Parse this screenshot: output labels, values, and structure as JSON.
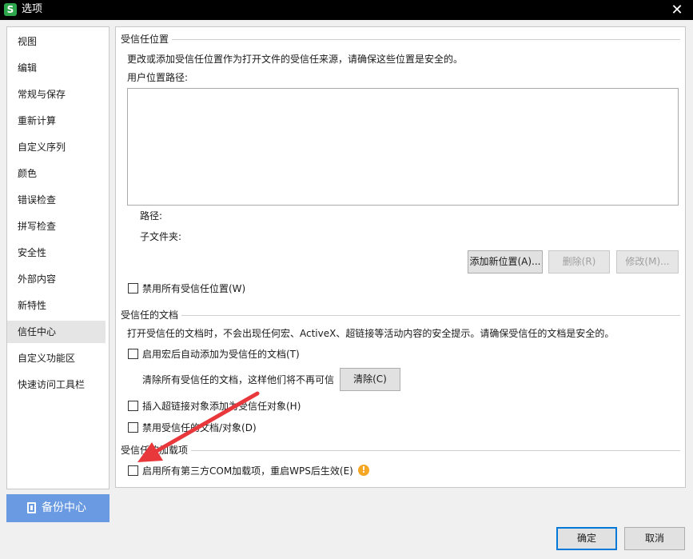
{
  "window": {
    "app_icon": "S",
    "title": "选项",
    "close_glyph": "✕"
  },
  "sidebar": {
    "items": [
      {
        "label": "视图"
      },
      {
        "label": "编辑"
      },
      {
        "label": "常规与保存"
      },
      {
        "label": "重新计算"
      },
      {
        "label": "自定义序列"
      },
      {
        "label": "颜色"
      },
      {
        "label": "错误检查"
      },
      {
        "label": "拼写检查"
      },
      {
        "label": "安全性"
      },
      {
        "label": "外部内容"
      },
      {
        "label": "新特性"
      },
      {
        "label": "信任中心",
        "selected": true
      },
      {
        "label": "自定义功能区"
      },
      {
        "label": "快速访问工具栏"
      }
    ],
    "backup_button": "备份中心"
  },
  "trusted_locations": {
    "title": "受信任位置",
    "description": "更改或添加受信任位置作为打开文件的受信任来源，请确保这些位置是安全的。",
    "user_path_label": "用户位置路径:",
    "path_label": "路径:",
    "subfolder_label": "子文件夹:",
    "add_button": "添加新位置(A)...",
    "delete_button": "删除(R)",
    "modify_button": "修改(M)...",
    "disable_all_checkbox": "禁用所有受信任位置(W)"
  },
  "trusted_documents": {
    "title": "受信任的文档",
    "description": "打开受信任的文档时，不会出现任何宏、ActiveX、超链接等活动内容的安全提示。请确保受信任的文档是安全的。",
    "macro_checkbox": "启用宏后自动添加为受信任的文档(T)",
    "clear_text": "清除所有受信任的文档，这样他们将不再可信",
    "clear_button": "清除(C)",
    "hyperlink_checkbox": "插入超链接对象添加为受信任对象(H)",
    "disable_checkbox": "禁用受信任的文档/对象(D)"
  },
  "trusted_addins": {
    "title": "受信任的加载项",
    "com_checkbox": "启用所有第三方COM加载项，重启WPS后生效(E)",
    "warning_icon": "!"
  },
  "footer": {
    "ok_button": "确定",
    "cancel_button": "取消"
  },
  "colors": {
    "titlebar": "#000000",
    "accent": "#6a9ae2",
    "arrow": "#e8383c",
    "warning": "#f5a623",
    "app_icon": "#2ea64b"
  }
}
